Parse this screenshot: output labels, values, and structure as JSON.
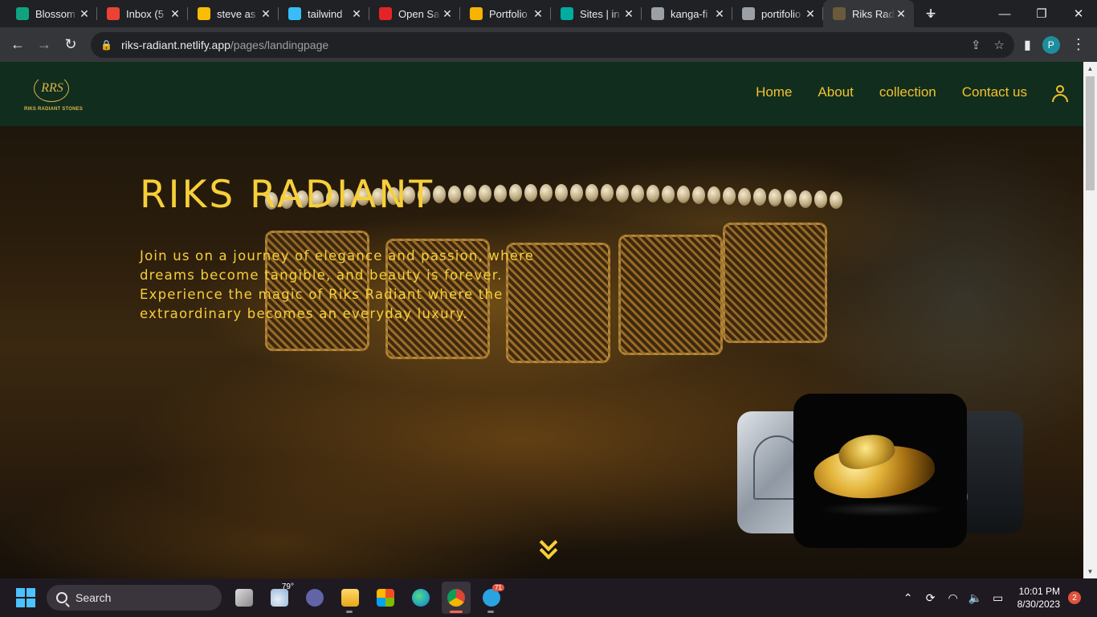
{
  "browser": {
    "tabs": [
      {
        "label": "Blossom",
        "favicon": "chatgpt-icon",
        "color": "#10a37f"
      },
      {
        "label": "Inbox (5",
        "favicon": "gmail-icon",
        "color": "#ea4335"
      },
      {
        "label": "steve as",
        "favicon": "google-drive-icon",
        "color": "#fbbc04"
      },
      {
        "label": "tailwind",
        "favicon": "tailwind-icon",
        "color": "#38bdf8"
      },
      {
        "label": "Open Sa",
        "favicon": "zoho-icon",
        "color": "#e42527"
      },
      {
        "label": "Portfolio",
        "favicon": "google-slides-icon",
        "color": "#f4b400"
      },
      {
        "label": "Sites | in",
        "favicon": "netlify-icon",
        "color": "#00ad9f"
      },
      {
        "label": "kanga-fi",
        "favicon": "globe-icon",
        "color": "#9aa0a6"
      },
      {
        "label": "portifolio",
        "favicon": "globe-icon",
        "color": "#9aa0a6"
      },
      {
        "label": "Riks Rad",
        "favicon": "riks-favicon",
        "color": "#6b5a3a"
      }
    ],
    "url_host": "riks-radiant.netlify.app",
    "url_path": "/pages/landingpage",
    "profile_initial": "P"
  },
  "site": {
    "logo_monogram": "RRS",
    "logo_tagline": "RIKS RADIANT STONES",
    "nav": [
      "Home",
      "About",
      "collection",
      "Contact us"
    ],
    "hero_title": "RIKS RADIANT",
    "hero_text": "Join us on a journey of elegance and passion, where dreams become tangible, and beauty is forever. Experience the magic of Riks Radiant where the extraordinary becomes an everyday luxury.",
    "accent_color": "#f6cf3a",
    "nav_bg": "#103020"
  },
  "taskbar": {
    "search_placeholder": "Search",
    "weather_temp": "79°",
    "telegram_badge": "71",
    "time": "10:01 PM",
    "date": "8/30/2023",
    "notification_count": "2"
  }
}
